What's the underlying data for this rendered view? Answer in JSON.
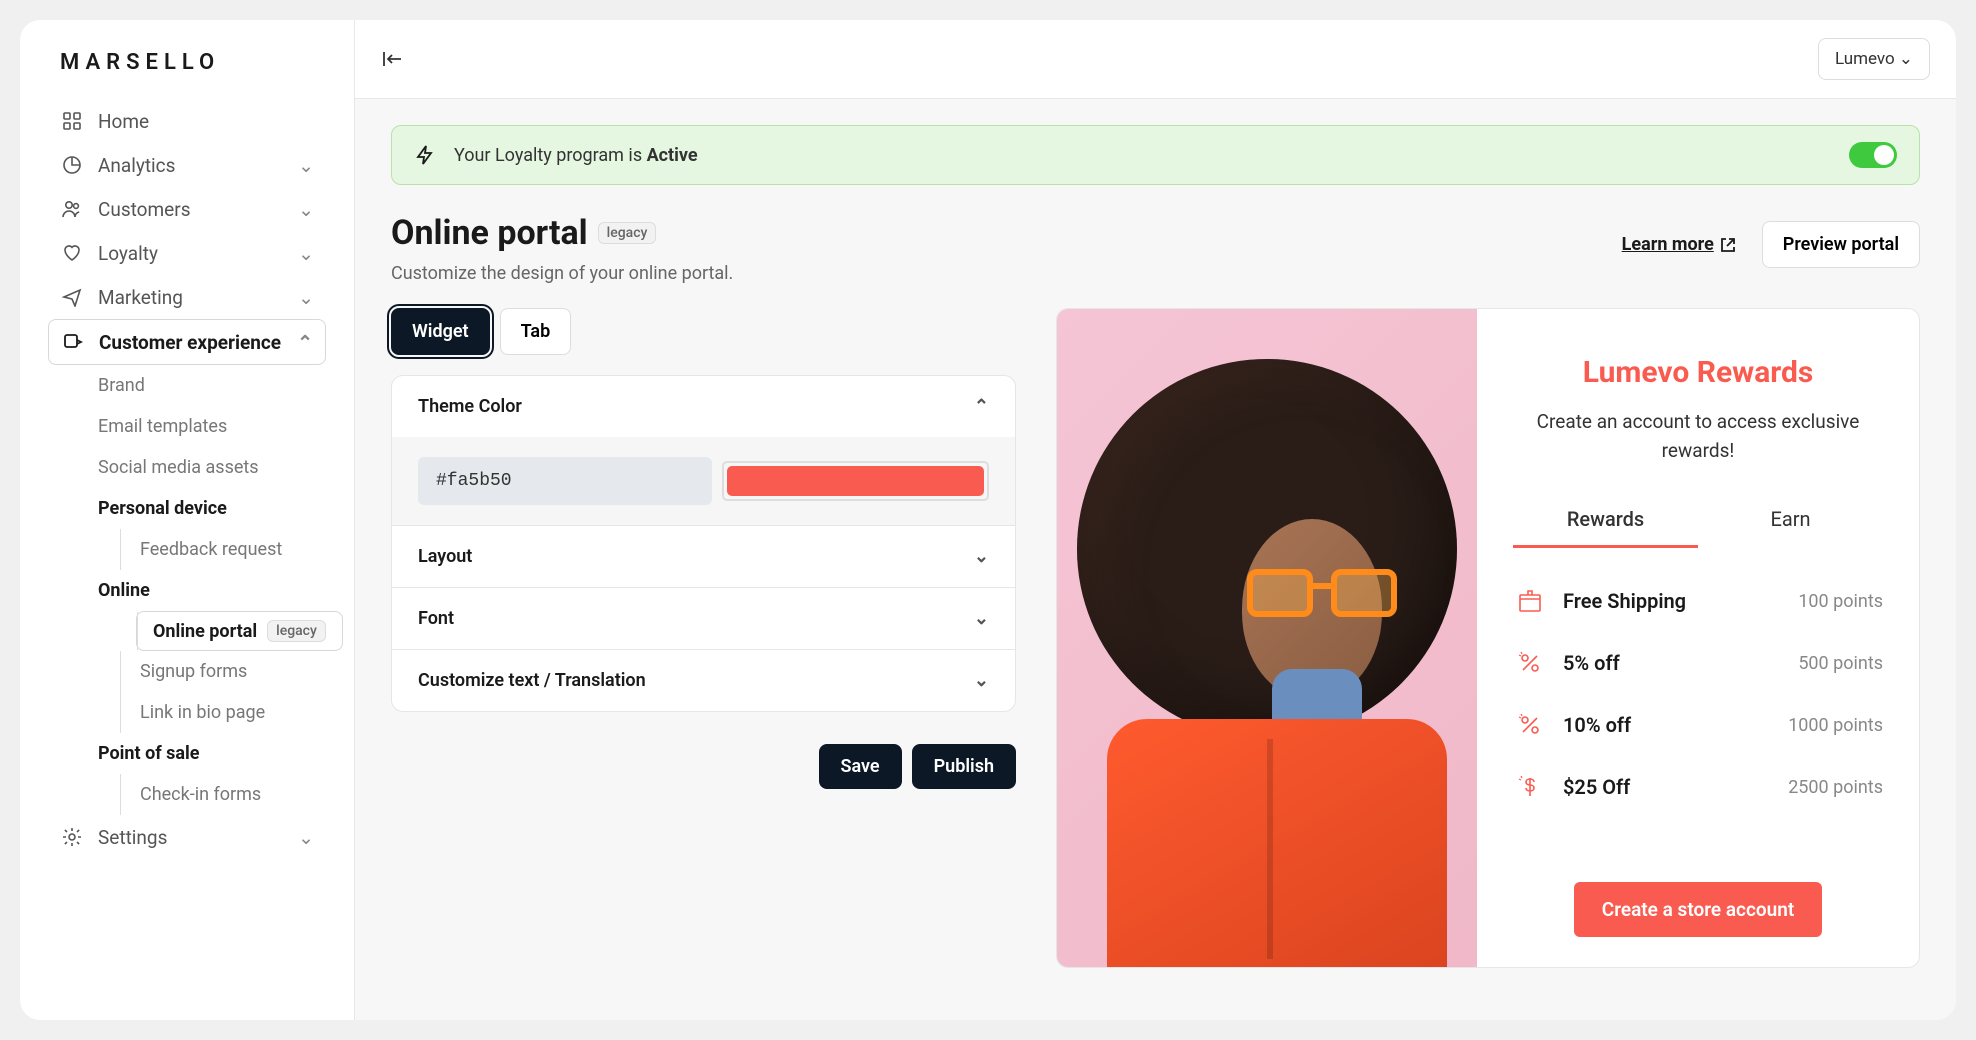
{
  "brand": "MARSELLO",
  "store_selector": "Lumevo",
  "sidebar": {
    "items": [
      {
        "label": "Home"
      },
      {
        "label": "Analytics"
      },
      {
        "label": "Customers"
      },
      {
        "label": "Loyalty"
      },
      {
        "label": "Marketing"
      },
      {
        "label": "Customer experience"
      },
      {
        "label": "Settings"
      }
    ],
    "cx_children": {
      "brand": "Brand",
      "email": "Email templates",
      "social": "Social media assets",
      "personal_heading": "Personal device",
      "feedback": "Feedback request",
      "online_heading": "Online",
      "online_portal": "Online portal",
      "online_portal_badge": "legacy",
      "signup": "Signup forms",
      "linkbio": "Link in bio page",
      "pos_heading": "Point of sale",
      "checkin": "Check-in forms"
    }
  },
  "banner": {
    "prefix": "Your Loyalty program is ",
    "status": "Active"
  },
  "page": {
    "title": "Online portal",
    "badge": "legacy",
    "subtitle": "Customize the design of your online portal.",
    "learn_more": "Learn more",
    "preview": "Preview portal"
  },
  "tabs": {
    "widget": "Widget",
    "tab": "Tab"
  },
  "accordion": {
    "theme": "Theme Color",
    "color_value": "#fa5b50",
    "layout": "Layout",
    "font": "Font",
    "customize": "Customize text / Translation"
  },
  "buttons": {
    "save": "Save",
    "publish": "Publish"
  },
  "preview": {
    "title": "Lumevo Rewards",
    "subtitle": "Create an account to access exclusive rewards!",
    "tabs": {
      "rewards": "Rewards",
      "earn": "Earn"
    },
    "rewards": [
      {
        "label": "Free Shipping",
        "points": "100 points"
      },
      {
        "label": "5% off",
        "points": "500 points"
      },
      {
        "label": "10% off",
        "points": "1000 points"
      },
      {
        "label": "$25 Off",
        "points": "2500 points"
      }
    ],
    "cta": "Create a store account",
    "theme_color": "#fa5b50"
  }
}
